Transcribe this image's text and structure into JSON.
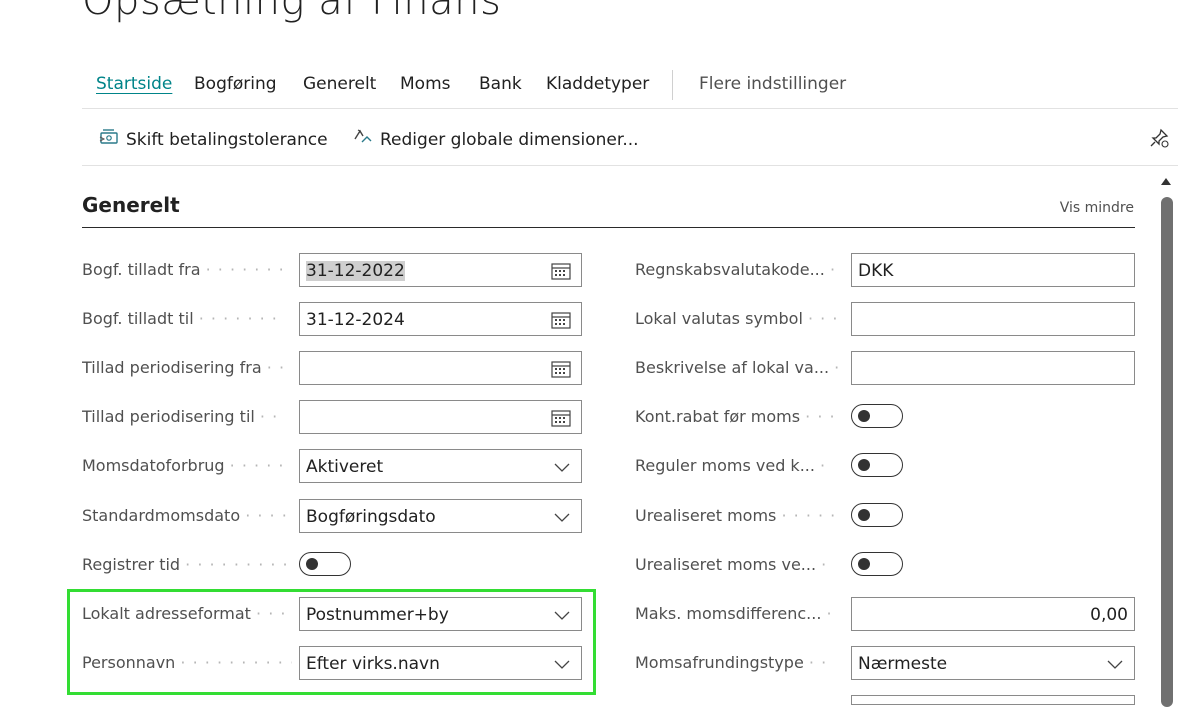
{
  "page": {
    "title": "Opsætning af Finans"
  },
  "nav": {
    "tabs": [
      {
        "label": "Startside",
        "active": true
      },
      {
        "label": "Bogføring"
      },
      {
        "label": "Generelt"
      },
      {
        "label": "Moms"
      },
      {
        "label": "Bank"
      },
      {
        "label": "Kladdetyper"
      }
    ],
    "more_label": "Flere indstillinger"
  },
  "actions": {
    "payment_tolerance": "Skift betalingstolerance",
    "dimensions": "Rediger globale dimensioner..."
  },
  "section": {
    "title": "Generelt",
    "toggle_label": "Vis mindre"
  },
  "left_fields": [
    {
      "label": "Bogf. tilladt fra",
      "value": "31-12-2022",
      "type": "date"
    },
    {
      "label": "Bogf. tilladt til",
      "value": "31-12-2024",
      "type": "date"
    },
    {
      "label": "Tillad periodisering fra",
      "value": "",
      "type": "date"
    },
    {
      "label": "Tillad periodisering til",
      "value": "",
      "type": "date"
    },
    {
      "label": "Momsdatoforbrug",
      "value": "Aktiveret",
      "type": "select"
    },
    {
      "label": "Standardmomsdato",
      "value": "Bogføringsdato",
      "type": "select"
    },
    {
      "label": "Registrer tid",
      "value": "",
      "type": "toggle",
      "checked": false
    },
    {
      "label": "Lokalt adresseformat",
      "value": "Postnummer+by",
      "type": "select"
    },
    {
      "label": "Personnavn",
      "value": "Efter virks.navn",
      "type": "select"
    }
  ],
  "right_fields": [
    {
      "label": "Regnskabsvalutakode...",
      "value": "DKK",
      "type": "text"
    },
    {
      "label": "Lokal valutas symbol",
      "value": "",
      "type": "text"
    },
    {
      "label": "Beskrivelse af lokal va...",
      "value": "",
      "type": "text"
    },
    {
      "label": "Kont.rabat før moms",
      "value": "",
      "type": "toggle",
      "checked": false
    },
    {
      "label": "Reguler moms ved k...",
      "value": "",
      "type": "toggle",
      "checked": false
    },
    {
      "label": "Urealiseret moms",
      "value": "",
      "type": "toggle",
      "checked": false
    },
    {
      "label": "Urealiseret moms ve...",
      "value": "",
      "type": "toggle",
      "checked": false
    },
    {
      "label": "Maks. momsdifferenc...",
      "value": "0,00",
      "type": "number"
    },
    {
      "label": "Momsafrundingstype",
      "value": "Nærmeste",
      "type": "select"
    }
  ],
  "colors": {
    "accent": "#008489",
    "highlight": "#33dd33"
  }
}
